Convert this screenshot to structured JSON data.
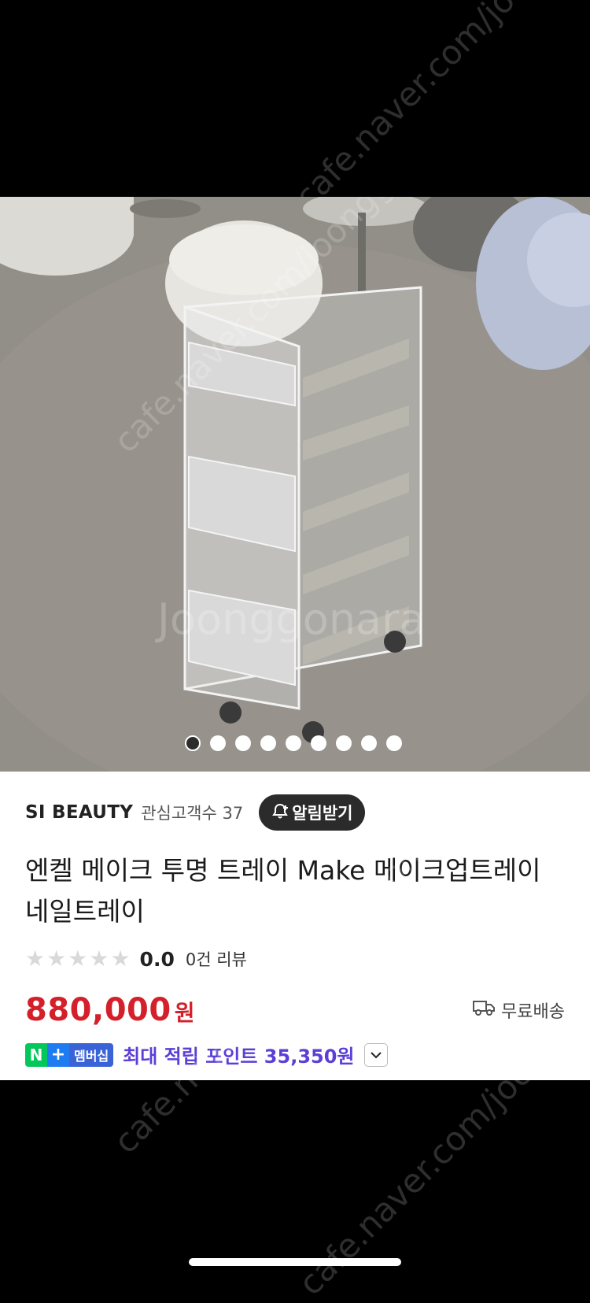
{
  "product_image": {
    "pagination": {
      "total": 9,
      "active_index": 0
    }
  },
  "seller": {
    "name": "SI BEAUTY",
    "followers": "관심고객수 37",
    "follow_label": "알림받기"
  },
  "product": {
    "title": "엔켈 메이크 투명 트레이 Make 메이크업트레이 네일트레이",
    "rating_value": "0.0",
    "rating_stars": 0,
    "review_count": "0건 리뷰",
    "price": "880,000",
    "currency": "원",
    "shipping": "무료배송"
  },
  "membership": {
    "badge_n": "N",
    "badge_plus": "+",
    "badge_label": "멤버십",
    "point_text": "최대 적립 포인트 35,350원"
  },
  "watermarks": {
    "site": "cafe.naver.com/joonggonara",
    "brand": "Joonggonara"
  },
  "colors": {
    "price": "#d4202a",
    "point": "#5b3fd6",
    "naver_green": "#03c75a",
    "naver_blue": "#1f7cf0"
  }
}
